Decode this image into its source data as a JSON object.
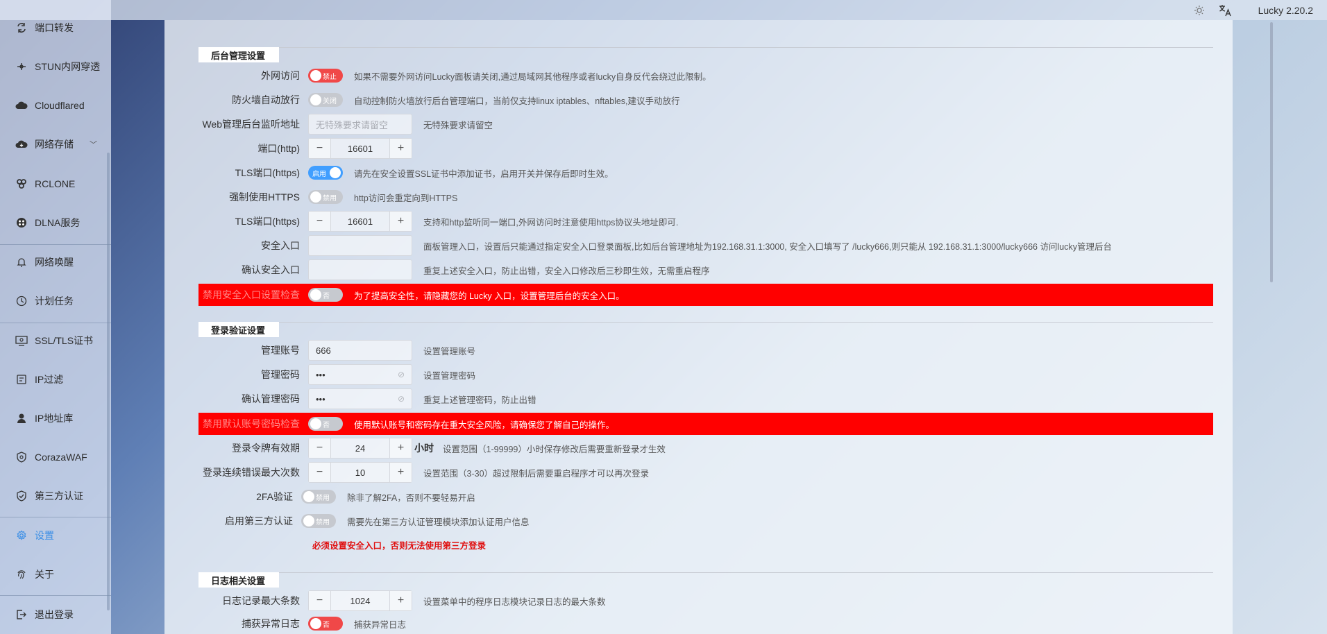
{
  "topbar": {
    "version": "Lucky 2.20.2",
    "theme_icon": "sun-icon",
    "lang_icon": "translate-icon"
  },
  "sidebar": {
    "items": [
      {
        "label": "端口转发",
        "icon": "port-forward-icon"
      },
      {
        "label": "STUN内网穿透",
        "icon": "stun-icon"
      },
      {
        "label": "Cloudflared",
        "icon": "cloud-icon"
      },
      {
        "label": "网络存储",
        "icon": "storage-icon"
      },
      {
        "label": "RCLONE",
        "icon": "rclone-icon"
      },
      {
        "label": "DLNA服务",
        "icon": "dlna-icon"
      },
      {
        "label": "网络唤醒",
        "icon": "bell-icon"
      },
      {
        "label": "计划任务",
        "icon": "clock-icon"
      },
      {
        "label": "SSL/TLS证书",
        "icon": "certificate-icon"
      },
      {
        "label": "IP过滤",
        "icon": "filter-icon"
      },
      {
        "label": "IP地址库",
        "icon": "user-icon"
      },
      {
        "label": "CorazaWAF",
        "icon": "shield-icon"
      },
      {
        "label": "第三方认证",
        "icon": "verify-icon"
      },
      {
        "label": "设置",
        "icon": "gear-icon"
      },
      {
        "label": "关于",
        "icon": "fingerprint-icon"
      },
      {
        "label": "退出登录",
        "icon": "logout-icon"
      }
    ]
  },
  "sections": {
    "admin": "后台管理设置",
    "login": "登录验证设置",
    "log": "日志相关设置"
  },
  "admin": {
    "wan": {
      "label": "外网访问",
      "toggle": "禁止",
      "hint": "如果不需要外网访问Lucky面板请关闭,通过局域网其他程序或者lucky自身反代会绕过此限制。"
    },
    "firewall": {
      "label": "防火墙自动放行",
      "toggle": "关闭",
      "hint": "自动控制防火墙放行后台管理端口，当前仅支持linux iptables、nftables,建议手动放行"
    },
    "listen": {
      "label": "Web管理后台监听地址",
      "placeholder": "无特殊要求请留空",
      "hint": "无特殊要求请留空"
    },
    "port": {
      "label": "端口(http)",
      "value": "16601"
    },
    "tls": {
      "label": "TLS端口(https)",
      "toggle": "启用",
      "hint": "请先在安全设置SSL证书中添加证书，启用开关并保存后即时生效。"
    },
    "force_https": {
      "label": "强制使用HTTPS",
      "toggle": "禁用",
      "hint": "http访问会重定向到HTTPS"
    },
    "tls_port": {
      "label": "TLS端口(https)",
      "value": "16601",
      "hint": "支持和http监听同一端口,外网访问时注意使用https协议头地址即可."
    },
    "safe_entry": {
      "label": "安全入口",
      "hint": "面板管理入口，设置后只能通过指定安全入口登录面板,比如后台管理地址为192.168.31.1:3000, 安全入口填写了 /lucky666,则只能从 192.168.31.1:3000/lucky666 访问lucky管理后台"
    },
    "confirm_entry": {
      "label": "确认安全入口",
      "hint": "重复上述安全入口，防止出错，安全入口修改后三秒即生效，无需重启程序"
    },
    "disable_entry_check": {
      "label": "禁用安全入口设置检查",
      "toggle": "否",
      "hint": "为了提高安全性，请隐藏您的 Lucky 入口，设置管理后台的安全入口。"
    }
  },
  "login": {
    "account": {
      "label": "管理账号",
      "value": "666",
      "hint": "设置管理账号"
    },
    "password": {
      "label": "管理密码",
      "value": "•••",
      "hint": "设置管理密码"
    },
    "confirm_password": {
      "label": "确认管理密码",
      "value": "•••",
      "hint": "重复上述管理密码，防止出错"
    },
    "disable_default_check": {
      "label": "禁用默认账号密码检查",
      "toggle": "否",
      "hint": "使用默认账号和密码存在重大安全风险，请确保您了解自己的操作。"
    },
    "token": {
      "label": "登录令牌有效期",
      "value": "24",
      "unit": "小时",
      "hint": "设置范围（1-99999）小时保存修改后需要重新登录才生效"
    },
    "max_errors": {
      "label": "登录连续错误最大次数",
      "value": "10",
      "hint": "设置范围（3-30）超过限制后需要重启程序才可以再次登录"
    },
    "twofa": {
      "label": "2FA验证",
      "toggle": "禁用",
      "hint": "除非了解2FA，否则不要轻易开启"
    },
    "third_party": {
      "label": "启用第三方认证",
      "toggle": "禁用",
      "hint": "需要先在第三方认证管理模块添加认证用户信息"
    },
    "warning": "必须设置安全入口，否则无法使用第三方登录"
  },
  "log": {
    "max_entries": {
      "label": "日志记录最大条数",
      "value": "1024",
      "hint": "设置菜单中的程序日志模块记录日志的最大条数"
    },
    "capture": {
      "label": "捕获异常日志",
      "toggle": "否",
      "hint": "捕获异常日志"
    }
  },
  "colors": {
    "accent": "#409eff",
    "danger": "#ff0000",
    "toggle_red": "#f04848"
  }
}
